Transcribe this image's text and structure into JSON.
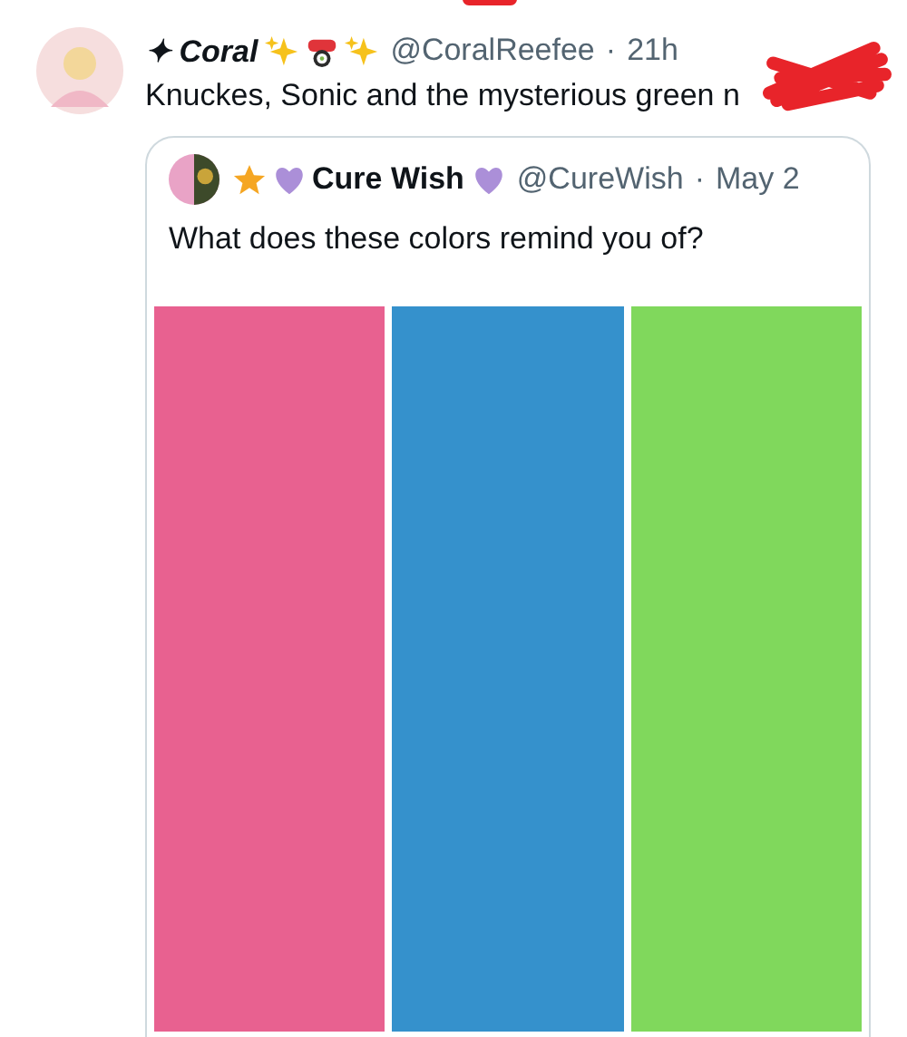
{
  "tweet": {
    "name": "✦ Coral",
    "handle": "@CoralReefee",
    "separator": "·",
    "time": "21h",
    "text": "Knuckes, Sonic and the mysterious green n",
    "quote": {
      "name": "Cure Wish",
      "handle": "@CureWish",
      "separator": "·",
      "time": "May 2",
      "text": "What does these colors remind you of?",
      "panels": [
        {
          "color": "#e86190"
        },
        {
          "color": "#3591cc"
        },
        {
          "color": "#80d85c"
        }
      ]
    }
  }
}
